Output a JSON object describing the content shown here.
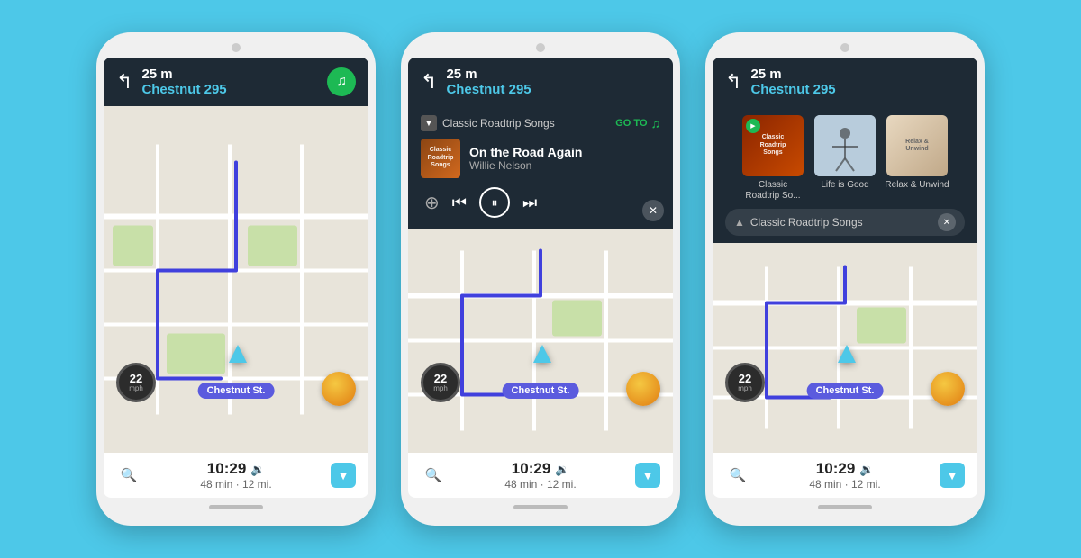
{
  "background_color": "#4dc8e8",
  "phones": [
    {
      "id": "phone1",
      "type": "basic",
      "nav": {
        "distance": "25 m",
        "street": "Chestnut 295",
        "turn_arrow": "↰"
      },
      "spotify_button": true,
      "map": {
        "speed": "22",
        "speed_unit": "mph",
        "location": "Chestnut St."
      },
      "bottom": {
        "time": "10:29",
        "duration": "48 min · 12 mi."
      }
    },
    {
      "id": "phone2",
      "type": "music",
      "nav": {
        "distance": "25 m",
        "street": "Chestnut 295",
        "turn_arrow": "↰"
      },
      "music": {
        "playlist": "Classic Roadtrip Songs",
        "goto_label": "GO TO",
        "track_title": "On the Road Again",
        "track_artist": "Willie Nelson",
        "album_label": "Classic\nRoadtrip Songs"
      },
      "map": {
        "speed": "22",
        "speed_unit": "mph",
        "location": "Chestnut St."
      },
      "bottom": {
        "time": "10:29",
        "duration": "48 min · 12 mi."
      }
    },
    {
      "id": "phone3",
      "type": "playlist",
      "nav": {
        "distance": "25 m",
        "street": "Chestnut 295",
        "turn_arrow": "↰"
      },
      "playlists": [
        {
          "id": "classic",
          "label": "Classic\nRoadtrip So...",
          "active": true
        },
        {
          "id": "life",
          "label": "Life is Good",
          "active": false
        },
        {
          "id": "relax",
          "label": "Relax &\nUnwind",
          "active": false
        }
      ],
      "current_playlist": "Classic Roadtrip Songs",
      "map": {
        "speed": "22",
        "speed_unit": "mph",
        "location": "Chestnut St."
      },
      "bottom": {
        "time": "10:29",
        "duration": "48 min · 12 mi."
      }
    }
  ]
}
